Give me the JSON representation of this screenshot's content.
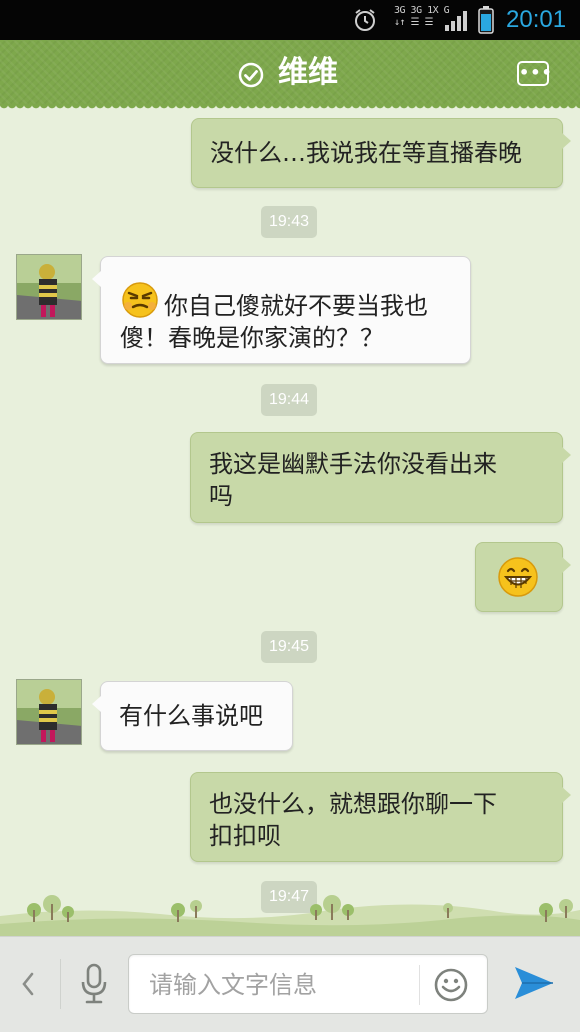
{
  "status_bar": {
    "network_line1": "3G 3G 1X G",
    "network_line2": "↓↑ ☰ ☰",
    "time": "20:01"
  },
  "header": {
    "title": "维维",
    "icons": {
      "verified": "check-circle-icon",
      "more": "more-dots-icon"
    }
  },
  "chat": {
    "messages": [
      {
        "type": "msg",
        "side": "right",
        "text": "没什么…我说我在等直播春晚"
      },
      {
        "type": "time",
        "text": "19:43"
      },
      {
        "type": "msg",
        "side": "left",
        "emoji": "angry-face-emoji",
        "line1": "你自己傻就好不要当我也",
        "line2": "傻！春晚是你家演的？？"
      },
      {
        "type": "time",
        "text": "19:44"
      },
      {
        "type": "msg",
        "side": "right",
        "line1": "我这是幽默手法你没看出来",
        "line2": "吗"
      },
      {
        "type": "msg",
        "side": "right",
        "emoji": "grin-face-emoji"
      },
      {
        "type": "time",
        "text": "19:45"
      },
      {
        "type": "msg",
        "side": "left",
        "text": "有什么事说吧"
      },
      {
        "type": "msg",
        "side": "right",
        "line1": "也没什么，就想跟你聊一下",
        "line2": "扣扣呗"
      },
      {
        "type": "time",
        "text": "19:47"
      }
    ]
  },
  "input_bar": {
    "placeholder": "请输入文字信息",
    "value": "",
    "icons": {
      "back": "chevron-left-icon",
      "voice": "microphone-icon",
      "emoji": "smiley-icon",
      "send": "send-icon"
    }
  },
  "colors": {
    "header": "#7ea84c",
    "chat_background": "#e8f0dc",
    "right_bubble": "#c8d9a8",
    "left_bubble": "#fbfbfb",
    "time_pill": "#cdd6c2",
    "clock": "#2aa8e0",
    "send": "#2a8ed8"
  }
}
